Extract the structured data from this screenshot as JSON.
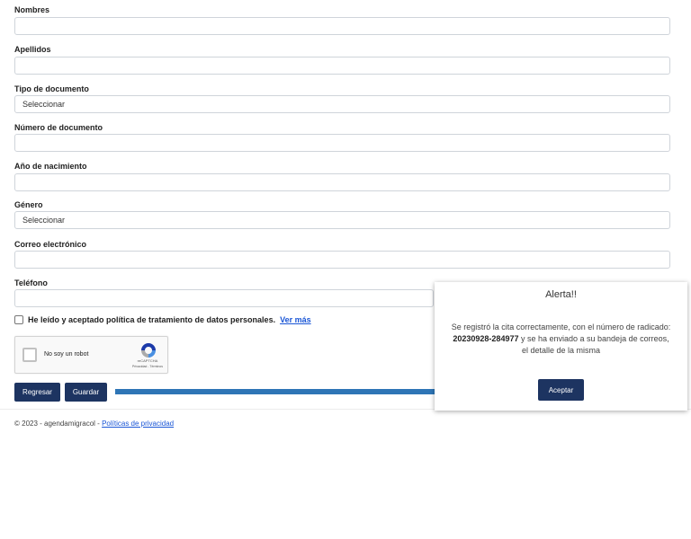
{
  "form": {
    "fields": [
      {
        "label": "Nombres",
        "value": ""
      },
      {
        "label": "Apellidos",
        "value": ""
      },
      {
        "label": "Tipo de documento",
        "value": "Seleccionar"
      },
      {
        "label": "Número de documento",
        "value": ""
      },
      {
        "label": "Año de nacimiento",
        "value": ""
      },
      {
        "label": "Género",
        "value": "Seleccionar"
      },
      {
        "label": "Correo electrónico",
        "value": ""
      },
      {
        "label": "Teléfono",
        "value": ""
      }
    ],
    "consent_text": "He leído y aceptado política de tratamiento de datos personales.",
    "consent_link": "Ver más",
    "recaptcha": {
      "label": "No soy un robot",
      "brand": "reCAPTCHA",
      "terms": "Privacidad - Términos"
    },
    "buttons": {
      "back": "Regresar",
      "save": "Guardar"
    }
  },
  "footer": {
    "text": "© 2023 - agendamigracol -",
    "link": "Políticas de privacidad"
  },
  "modal": {
    "title": "Alerta!!",
    "msg_before": "Se registró la cita correctamente, con el número de radicado:",
    "radicado": "20230928-284977",
    "msg_after": "y se ha enviado a su bandeja de correos, el detalle de la misma",
    "accept": "Aceptar"
  },
  "colors": {
    "primary_button": "#1d3461",
    "link": "#1a56d6",
    "arrow": "#2e75b6"
  },
  "icons": {
    "recaptcha": "recaptcha-logo-icon",
    "arrow": "arrow-right-icon"
  }
}
